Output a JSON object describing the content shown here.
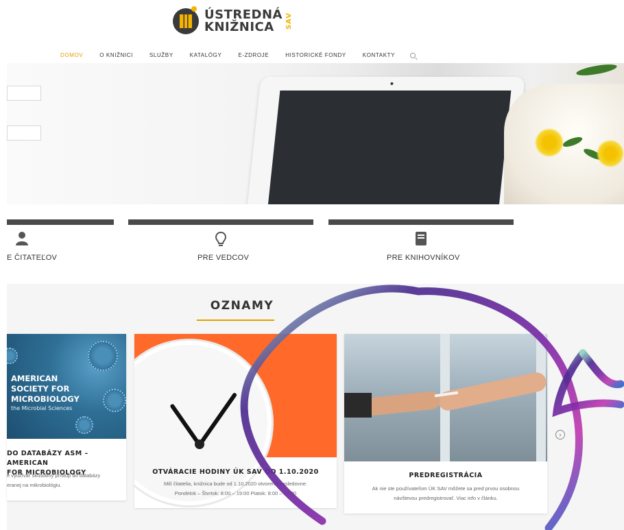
{
  "logo": {
    "line1": "ÚSTREDNÁ",
    "line2": "KNIŽNICA",
    "vertical": "SAV"
  },
  "nav": {
    "items": [
      "DOMOV",
      "O KNIŽNICI",
      "SLUŽBY",
      "KATALÓGY",
      "E-ZDROJE",
      "HISTORICKÉ FONDY",
      "KONTAKTY"
    ],
    "active": "DOMOV",
    "search_icon": "search-icon"
  },
  "categories": [
    {
      "label": "E ČITATEĽOV",
      "icon": "user-icon"
    },
    {
      "label": "PRE VEDCOV",
      "icon": "lightbulb-icon"
    },
    {
      "label": "PRE KNIHOVNÍKOV",
      "icon": "book-icon"
    }
  ],
  "section": {
    "title": "OZNAMY"
  },
  "cards": [
    {
      "image_lines": [
        "AMERICAN",
        "SOCIETY FOR",
        "MICROBIOLOGY"
      ],
      "image_sub": "the Microbial Sciences",
      "title_line1": "DO DATABÁZY ASM – AMERICAN",
      "title_line2": "FOR MICROBIOLOGY",
      "text_line1": "e využívať skúšobný prístup do databázy",
      "text_line2": "eranej na mikrobiológiu."
    },
    {
      "title": "OTVÁRACIE HODINY ÚK SAV OD 1.10.2020",
      "text_line1": "Milí čitatelia, knižnica bude od 1.10.2020 otvorená nasledovne:",
      "text_line2": "Pondelok – Štvrtok: 8:00 – 19:00 Piatok: 8:00 – 17:00"
    },
    {
      "title": "PREDREGISTRÁCIA",
      "text_line1": "Ak nie ste používateľom ÚK SAV môžete sa pred prvou osobnou",
      "text_line2": "návštevou predregistrovať. Viac info v článku."
    }
  ],
  "colors": {
    "accent": "#e0a000",
    "dark": "#4a4a4a",
    "section_bg": "#f5f5f5"
  }
}
